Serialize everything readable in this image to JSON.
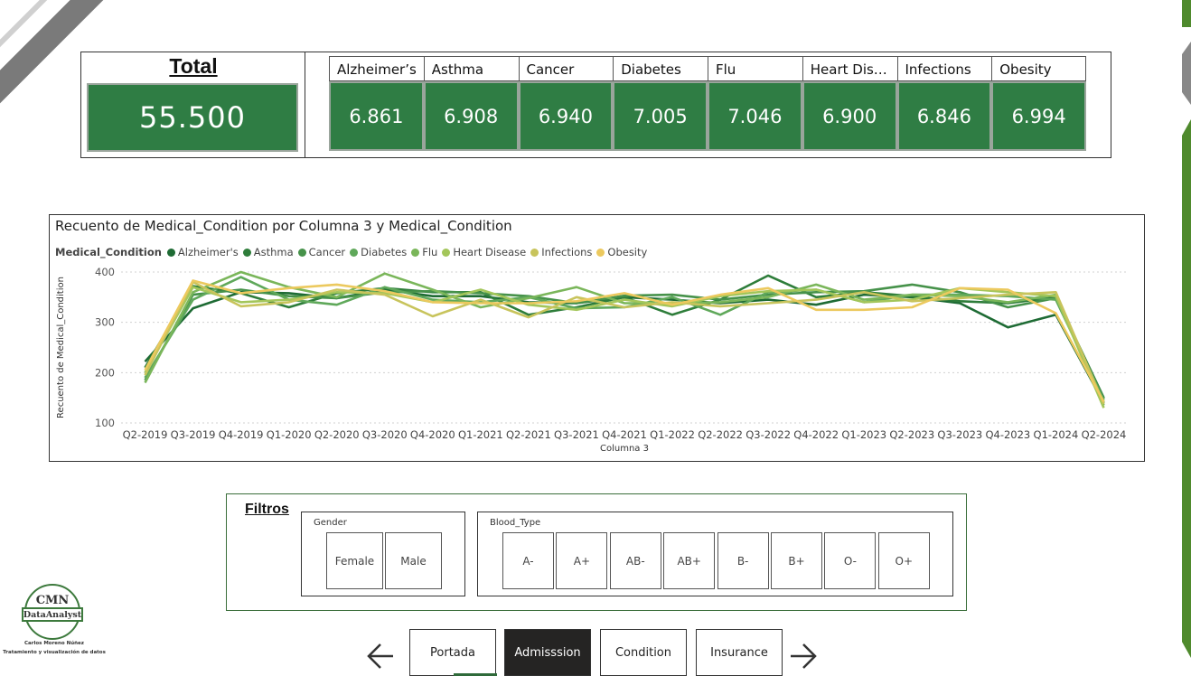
{
  "kpi": {
    "total_label": "Total",
    "total_value": "55.500",
    "conditions": [
      {
        "name": "Alzheimer’s",
        "value": "6.861"
      },
      {
        "name": "Asthma",
        "value": "6.908"
      },
      {
        "name": "Cancer",
        "value": "6.940"
      },
      {
        "name": "Diabetes",
        "value": "7.005"
      },
      {
        "name": "Flu",
        "value": "7.046"
      },
      {
        "name": "Heart Dis…",
        "value": "6.900"
      },
      {
        "name": "Infections",
        "value": "6.846"
      },
      {
        "name": "Obesity",
        "value": "6.994"
      }
    ]
  },
  "chart_data": {
    "type": "line",
    "title": "Recuento de Medical_Condition por Columna 3 y Medical_Condition",
    "legend_title": "Medical_Condition",
    "legend_position": "top-left",
    "xlabel": "Columna 3",
    "ylabel": "Recuento de Medical_Condition",
    "ylim": [
      100,
      400
    ],
    "yticks": [
      100,
      200,
      300,
      400
    ],
    "grid": true,
    "categories": [
      "Q2-2019",
      "Q3-2019",
      "Q4-2019",
      "Q1-2020",
      "Q2-2020",
      "Q3-2020",
      "Q4-2020",
      "Q1-2021",
      "Q2-2021",
      "Q3-2021",
      "Q4-2021",
      "Q1-2022",
      "Q2-2022",
      "Q3-2022",
      "Q4-2022",
      "Q1-2023",
      "Q2-2023",
      "Q3-2023",
      "Q4-2023",
      "Q1-2024",
      "Q2-2024"
    ],
    "series": [
      {
        "name": "Alzheimer's",
        "color": "#1e6b34",
        "values": [
          222,
          328,
          360,
          358,
          348,
          365,
          352,
          352,
          340,
          338,
          350,
          345,
          338,
          345,
          335,
          355,
          350,
          338,
          290,
          315,
          140
        ]
      },
      {
        "name": "Asthma",
        "color": "#2e7d3a",
        "values": [
          210,
          372,
          358,
          330,
          358,
          368,
          360,
          360,
          315,
          330,
          350,
          315,
          345,
          393,
          350,
          360,
          352,
          342,
          338,
          350,
          150
        ]
      },
      {
        "name": "Cancer",
        "color": "#46924a",
        "values": [
          185,
          355,
          365,
          352,
          348,
          360,
          362,
          358,
          352,
          338,
          353,
          355,
          345,
          355,
          360,
          362,
          375,
          360,
          330,
          348,
          148
        ]
      },
      {
        "name": "Diabetes",
        "color": "#5fa85a",
        "values": [
          190,
          345,
          390,
          345,
          335,
          370,
          345,
          340,
          350,
          328,
          330,
          350,
          315,
          360,
          365,
          340,
          355,
          355,
          352,
          345,
          145
        ]
      },
      {
        "name": "Flu",
        "color": "#7ab65a",
        "values": [
          180,
          360,
          400,
          370,
          350,
          397,
          365,
          330,
          348,
          370,
          338,
          338,
          340,
          350,
          375,
          345,
          355,
          352,
          340,
          355,
          135
        ]
      },
      {
        "name": "Heart Disease",
        "color": "#a3c65a",
        "values": [
          200,
          370,
          340,
          345,
          360,
          358,
          340,
          365,
          335,
          325,
          345,
          332,
          352,
          362,
          365,
          340,
          345,
          368,
          360,
          352,
          130
        ]
      },
      {
        "name": "Infections",
        "color": "#c8c45c",
        "values": [
          195,
          380,
          332,
          340,
          365,
          355,
          312,
          345,
          310,
          350,
          330,
          340,
          332,
          338,
          345,
          360,
          342,
          348,
          355,
          360,
          138
        ]
      },
      {
        "name": "Obesity",
        "color": "#ecc95e",
        "values": [
          205,
          383,
          358,
          368,
          375,
          362,
          340,
          338,
          338,
          342,
          358,
          335,
          355,
          368,
          325,
          325,
          330,
          368,
          365,
          318,
          142
        ]
      }
    ]
  },
  "filters": {
    "title": "Filtros",
    "gender": {
      "title": "Gender",
      "options": [
        "Female",
        "Male"
      ]
    },
    "blood_type": {
      "title": "Blood_Type",
      "options": [
        "A-",
        "A+",
        "AB-",
        "AB+",
        "B-",
        "B+",
        "O-",
        "O+"
      ]
    }
  },
  "nav": {
    "items": [
      "Portada",
      "Admisssion",
      "Condition",
      "Insurance"
    ],
    "active": "Admisssion"
  },
  "logo": {
    "initials": "CMN",
    "banner": "DataAnalyst",
    "name": "Carlos Moreno Núñez",
    "tagline": "Tratamiento y visualización de datos"
  },
  "colors": {
    "kpi_green": "#2f7d44",
    "accent_green": "#4f8a2d",
    "active_nav": "#252423"
  }
}
